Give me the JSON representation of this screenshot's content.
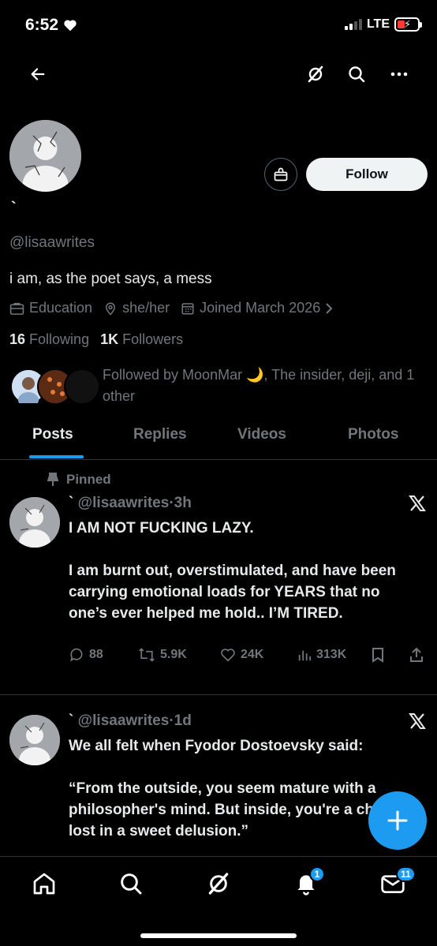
{
  "status_bar": {
    "time": "6:52",
    "network": "LTE"
  },
  "profile": {
    "display_name": "`",
    "handle": "@lisaawrites",
    "bio": "i am, as the poet says, a mess",
    "category": "Education",
    "pronouns": "she/her",
    "joined": "Joined March 2026",
    "following_count": "16",
    "following_label": "Following",
    "followers_count": "1K",
    "followers_label": "Followers",
    "followed_by": "Followed by MoonMar 🌙, The insider, deji, and 1 other",
    "follow_button": "Follow"
  },
  "tabs": [
    {
      "label": "Posts",
      "active": true
    },
    {
      "label": "Replies"
    },
    {
      "label": "Videos"
    },
    {
      "label": "Photos"
    }
  ],
  "posts": [
    {
      "pinned_label": "Pinned",
      "author": "`",
      "handle": "@lisaawrites",
      "time": "3h",
      "text_line1": "I AM NOT FUCKING LAZY.",
      "text_line2": "I am burnt out, overstimulated, and have been carrying emotional loads for YEARS that no one’s ever helped me hold.. I’M TIRED.",
      "replies": "88",
      "reposts": "5.9K",
      "likes": "24K",
      "views": "313K"
    },
    {
      "author": "`",
      "handle": "@lisaawrites",
      "time": "1d",
      "text_line1": "We all felt when Fyodor Dostoevsky said:",
      "text_line2": "“From the outside, you seem mature with a philosopher's mind. But inside, you're a child lost in a sweet delusion.”"
    }
  ],
  "bottom_nav": {
    "notifications_badge": "1",
    "messages_badge": "11"
  },
  "colors": {
    "accent": "#1d9bf0",
    "background": "#000000",
    "muted": "#71767b"
  }
}
